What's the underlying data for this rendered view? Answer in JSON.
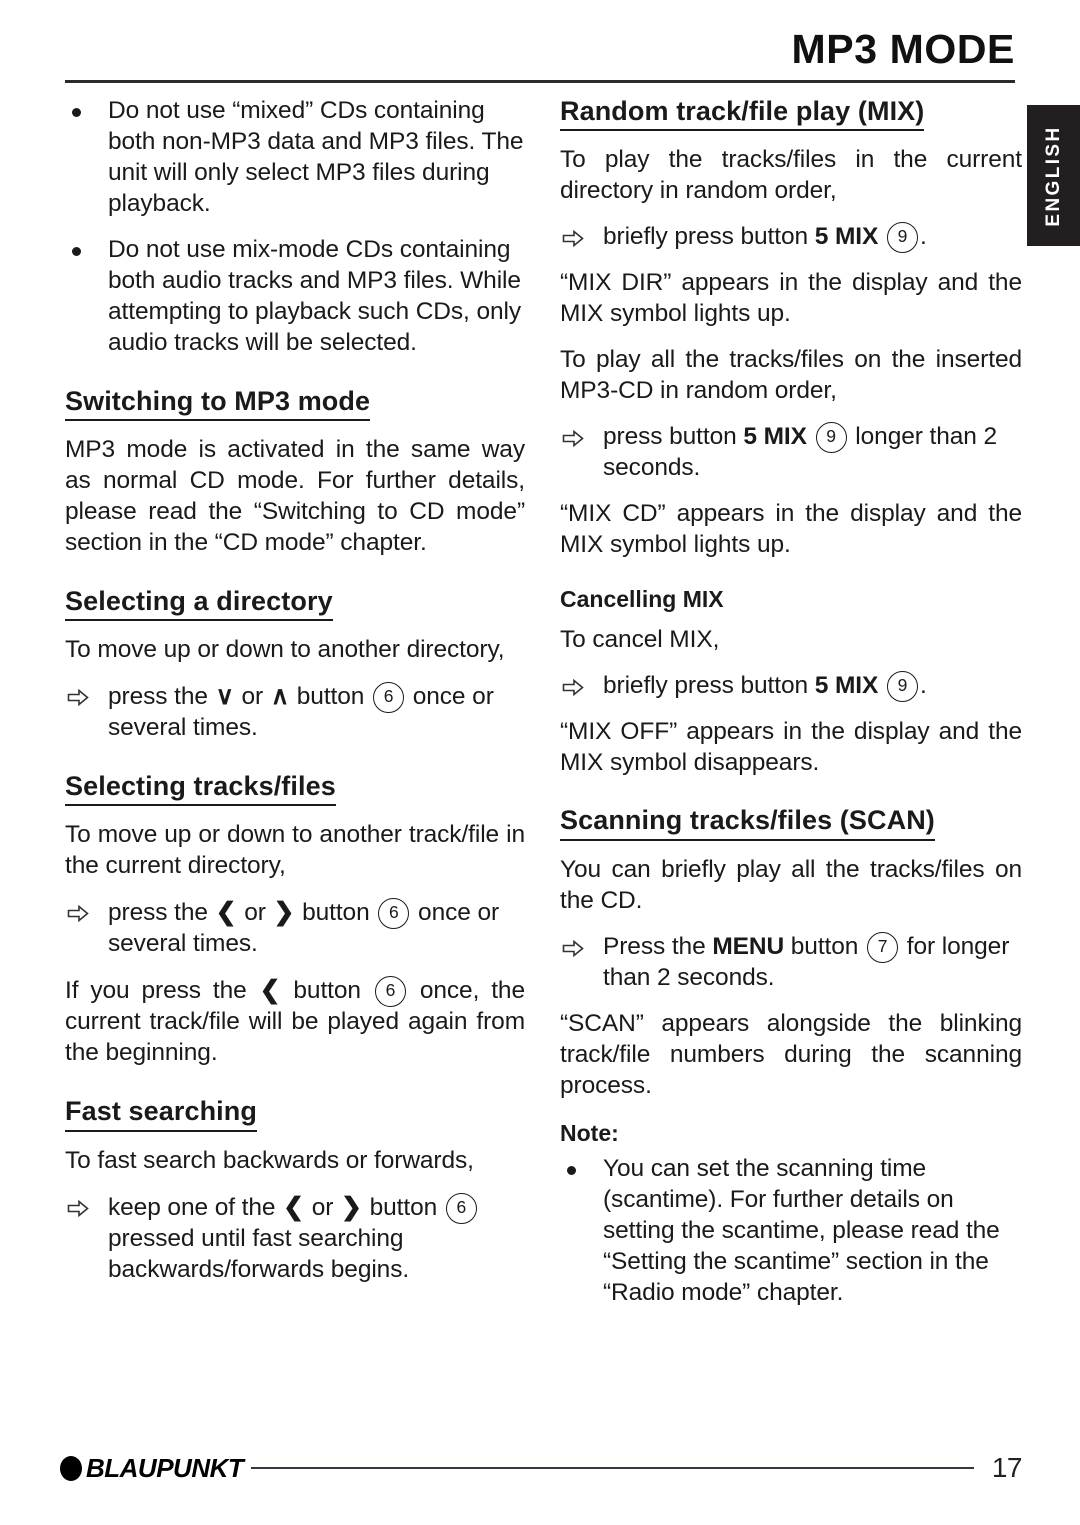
{
  "header": {
    "title": "MP3 MODE"
  },
  "language_tab": {
    "label": "ENGLISH"
  },
  "left_column": {
    "warnings": [
      "Do not use “mixed” CDs containing both non-MP3 data and MP3 files. The unit will only select MP3 files during playback.",
      "Do not use mix-mode CDs containing both audio tracks and MP3 files. While attempting to playback such CDs, only audio tracks will be selected."
    ],
    "switching": {
      "heading": "Switching to MP3 mode",
      "paragraph": "MP3 mode is activated in the same way as normal CD mode. For further details, please read the “Switching to CD mode” section in the “CD mode” chapter."
    },
    "selecting_directory": {
      "heading": "Selecting a directory",
      "intro": "To move up or down to another directory,",
      "step": {
        "pre": "press the",
        "chev_down": "∨",
        "mid": "or",
        "chev_up": "∧",
        "post": "button",
        "button_ref": "6",
        "tail": "once or several times."
      }
    },
    "selecting_tracks": {
      "heading": "Selecting tracks/files",
      "intro": "To move up or down to another track/file in the current directory,",
      "step": {
        "pre": "press the",
        "chev_left": "❮",
        "mid": "or",
        "chev_right": "❯",
        "post": "button",
        "button_ref": "6",
        "tail": "once or several times."
      },
      "note_pre": "If you press the",
      "note_chev": "❮",
      "note_mid": "button",
      "note_ref": "6",
      "note_tail": "once, the current track/file will be played again from the beginning."
    },
    "fast_searching": {
      "heading": "Fast searching",
      "intro": "To fast search backwards or forwards,",
      "step": {
        "pre": "keep one of the",
        "chev_left": "❮",
        "mid": "or",
        "chev_right": "❯",
        "post": "button",
        "button_ref": "6",
        "tail": "pressed until fast searching backwards/forwards begins."
      }
    }
  },
  "right_column": {
    "random_play": {
      "heading": "Random track/file play (MIX)",
      "intro_dir": "To play the tracks/files in the current directory in random order,",
      "step_dir": {
        "pre": "briefly press button",
        "button_label": "5 MIX",
        "button_ref": "9",
        "tail": "."
      },
      "result_dir": "“MIX DIR” appears in the display and the MIX symbol lights up.",
      "intro_cd": "To play all the tracks/files on the inserted MP3-CD in random order,",
      "step_cd": {
        "pre": "press button",
        "button_label": "5 MIX",
        "button_ref": "9",
        "tail": "longer than 2 seconds."
      },
      "result_cd": "“MIX CD” appears in the display and the MIX symbol lights up."
    },
    "cancelling_mix": {
      "heading": "Cancelling MIX",
      "intro": "To cancel MIX,",
      "step": {
        "pre": "briefly press button",
        "button_label": "5 MIX",
        "button_ref": "9",
        "tail": "."
      },
      "result": "“MIX OFF” appears in the display and the MIX symbol disappears."
    },
    "scanning": {
      "heading": "Scanning tracks/files (SCAN)",
      "intro": "You can briefly play all the tracks/files on the CD.",
      "step": {
        "pre": "Press the",
        "button_label": "MENU",
        "post": "button",
        "button_ref": "7",
        "tail": "for longer than 2 seconds."
      },
      "result": "“SCAN” appears alongside the blinking track/file numbers during the scanning process."
    },
    "note": {
      "heading": "Note:",
      "items": [
        "You can set the scanning time (scantime). For further details on setting the scantime, please read the  “Setting the scantime” section in the “Radio mode” chapter."
      ]
    }
  },
  "footer": {
    "brand": "BLAUPUNKT",
    "page_number": "17"
  }
}
